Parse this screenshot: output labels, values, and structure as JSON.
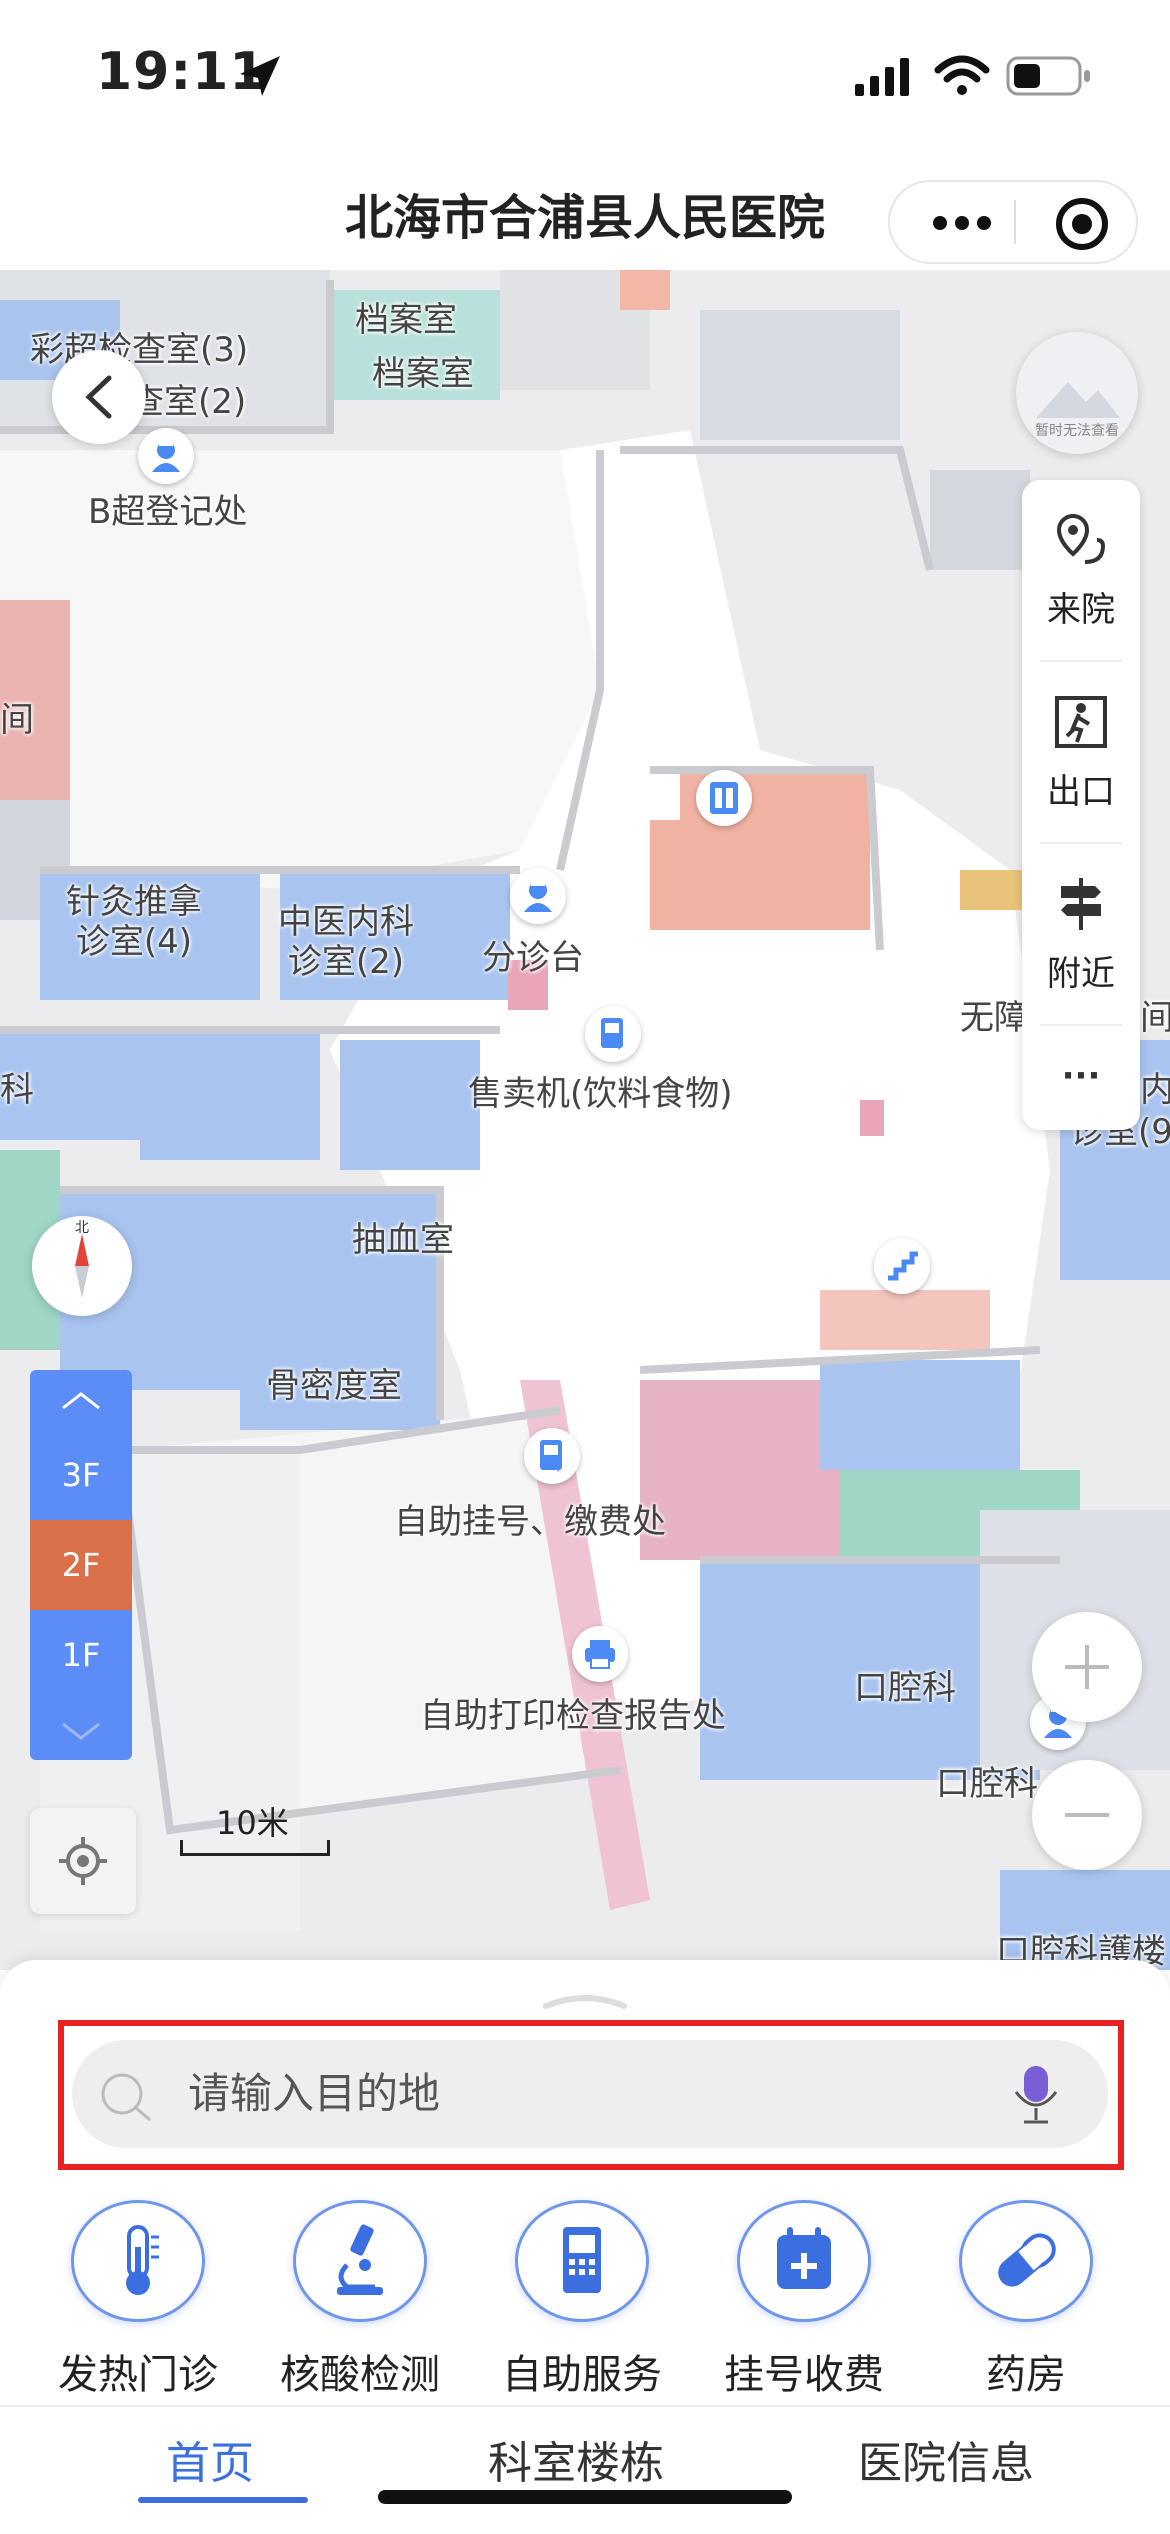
{
  "status_bar": {
    "time": "19:11"
  },
  "nav": {
    "title": "北海市合浦县人民医院"
  },
  "map": {
    "labels": {
      "caichao3": "彩超检查室(3)",
      "jianchashi2": "查室(2)",
      "dangan1": "档案室",
      "dangan2": "档案室",
      "bchao": "B超登记处",
      "jian": "间",
      "zhenjiu": "针灸推拿\n诊室(4)",
      "zhongyi": "中医内科\n诊室(2)",
      "fenzhen": "分诊台",
      "shoumaiji": "售卖机(饮料食物)",
      "ke": "科",
      "chouxue": "抽血室",
      "gumidu": "骨密度室",
      "zizhu_guahao": "自助挂号、缴费处",
      "zizhu_dayin": "自助打印检查报告处",
      "kouqiang": "口腔科",
      "kouqiang2": "口腔科",
      "wuzhang": "无障",
      "zhenshi9": "诊室(9",
      "kouqiang3": "口腔科護楼",
      "nei": "内",
      "jian2": "间"
    },
    "compass_label": "北",
    "scale_label": "10米",
    "preview_label": "暂时无法查看"
  },
  "side_panel": {
    "items": [
      {
        "label": "来院",
        "icon": "route-pin-icon"
      },
      {
        "label": "出口",
        "icon": "exit-icon"
      },
      {
        "label": "附近",
        "icon": "signpost-icon"
      },
      {
        "label": "···",
        "icon": "more-icon"
      }
    ]
  },
  "floors": {
    "items": [
      "3F",
      "2F",
      "1F"
    ],
    "selected": "2F",
    "selected_color": "#d9704a"
  },
  "search": {
    "placeholder": "请输入目的地"
  },
  "quick_actions": [
    {
      "label": "发热门诊",
      "icon": "thermometer-icon"
    },
    {
      "label": "核酸检测",
      "icon": "microscope-icon"
    },
    {
      "label": "自助服务",
      "icon": "kiosk-icon"
    },
    {
      "label": "挂号收费",
      "icon": "calendar-plus-icon"
    },
    {
      "label": "药房",
      "icon": "pill-icon"
    }
  ],
  "tabs": [
    {
      "label": "首页",
      "active": true
    },
    {
      "label": "科室楼栋",
      "active": false
    },
    {
      "label": "医院信息",
      "active": false
    }
  ],
  "colors": {
    "accent": "#3b6fe0",
    "highlight": "#e62222",
    "floor_panel": "#5c8cf5"
  }
}
